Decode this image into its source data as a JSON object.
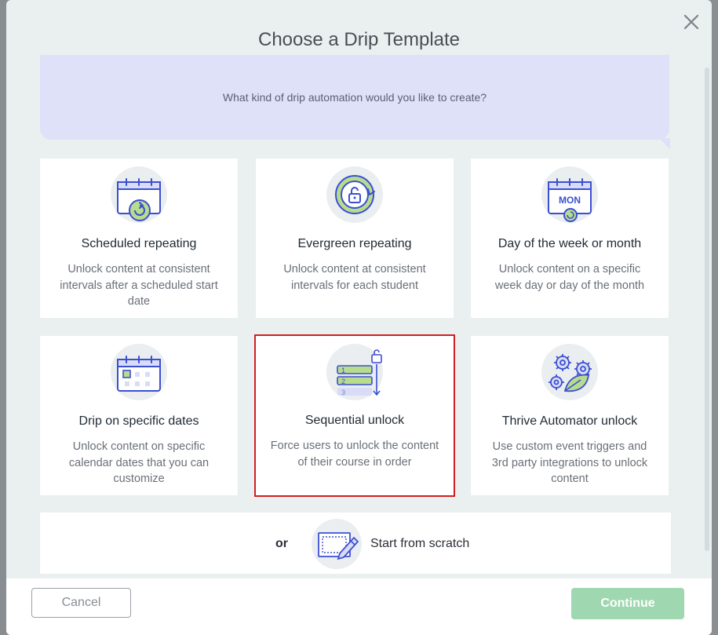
{
  "modal": {
    "title": "Choose a Drip Template",
    "prompt": "What kind of drip automation would you like to create?"
  },
  "templates": [
    {
      "title": "Scheduled repeating",
      "description": "Unlock content at consistent intervals after a scheduled start date",
      "icon": "calendar-repeat-icon"
    },
    {
      "title": "Evergreen repeating",
      "description": "Unlock content at consistent intervals for each student",
      "icon": "evergreen-unlock-cycle-icon"
    },
    {
      "title": "Day of the week or month",
      "description": "Unlock content on a specific week day or day of the month",
      "icon": "calendar-mon-icon",
      "icon_text": "MON"
    },
    {
      "title": "Drip on specific dates",
      "description": "Unlock content on specific calendar dates that you can customize",
      "icon": "calendar-dates-icon"
    },
    {
      "title": "Sequential unlock",
      "description": "Force users to unlock the content of their course in order",
      "icon": "sequential-list-icon",
      "selected": true,
      "icon_numbers": [
        "1",
        "2",
        "3"
      ]
    },
    {
      "title": "Thrive Automator unlock",
      "description": "Use custom event triggers and 3rd party integrations to unlock content",
      "icon": "gears-leaf-icon"
    }
  ],
  "scratch": {
    "or_label": "or",
    "label": "Start from scratch",
    "icon": "edit-pencil-icon"
  },
  "footer": {
    "cancel_label": "Cancel",
    "continue_label": "Continue"
  },
  "colors": {
    "accent_blue": "#3c4fd1",
    "accent_green": "#9fd8b0",
    "icon_green": "#b7dc8e",
    "selected_outline": "#d11f1f",
    "prompt_bg": "#dee1f7"
  }
}
